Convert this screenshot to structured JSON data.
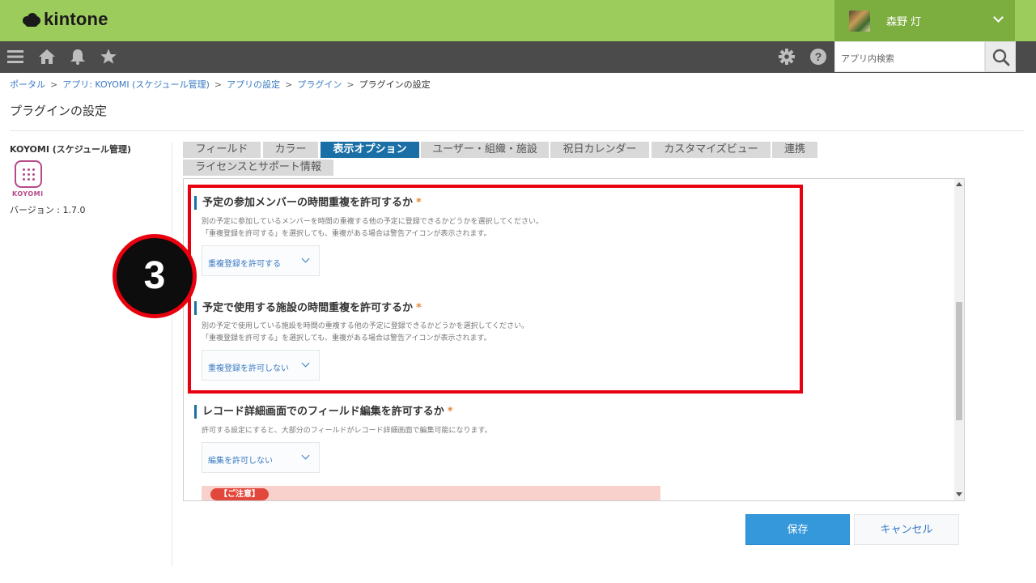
{
  "header": {
    "app_name": "kintone",
    "user_name": "森野 灯"
  },
  "toolbar": {
    "search_placeholder": "アプリ内検索"
  },
  "breadcrumb": [
    "ポータル",
    "アプリ: KOYOMI (スケジュール管理)",
    "アプリの設定",
    "プラグイン",
    "プラグインの設定"
  ],
  "page": {
    "title": "プラグインの設定"
  },
  "plugin": {
    "name": "KOYOMI (スケジュール管理)",
    "icon_label": "KOYOMI",
    "version": "バージョン : 1.7.0"
  },
  "tabs": [
    {
      "label": "フィールド",
      "active": false
    },
    {
      "label": "カラー",
      "active": false
    },
    {
      "label": "表示オプション",
      "active": true
    },
    {
      "label": "ユーザー・組織・施設",
      "active": false
    },
    {
      "label": "祝日カレンダー",
      "active": false
    },
    {
      "label": "カスタマイズビュー",
      "active": false
    },
    {
      "label": "連携",
      "active": false
    },
    {
      "label": "ライセンスとサポート情報",
      "active": false
    }
  ],
  "settings": [
    {
      "heading": "予定の参加メンバーの時間重複を許可するか",
      "required_mark": "*",
      "desc1": "別の予定に参加しているメンバーを時間の重複する他の予定に登録できるかどうかを選択してください。",
      "desc2": "「重複登録を許可する」を選択しても、重複がある場合は警告アイコンが表示されます。",
      "value": "重複登録を許可する"
    },
    {
      "heading": "予定で使用する施設の時間重複を許可するか",
      "required_mark": "*",
      "desc1": "別の予定で使用している施設を時間の重複する他の予定に登録できるかどうかを選択してください。",
      "desc2": "「重複登録を許可する」を選択しても、重複がある場合は警告アイコンが表示されます。",
      "value": "重複登録を許可しない"
    },
    {
      "heading": "レコード詳細画面でのフィールド編集を許可するか",
      "required_mark": "*",
      "desc1": "許可する設定にすると、大部分のフィールドがレコード詳細画面で編集可能になります。",
      "value": "編集を許可しない"
    }
  ],
  "notice": {
    "badge": "【ご注意】"
  },
  "annotation": {
    "step_number": "3"
  },
  "buttons": {
    "save": "保存",
    "cancel": "キャンセル"
  },
  "colors": {
    "header_green": "#9ccc5c",
    "user_area_green": "#7cae3f",
    "nav_gray": "#4b4b4b",
    "active_tab": "#1a6fa6",
    "save_blue": "#3498db",
    "highlight_red": "#e8000e"
  }
}
